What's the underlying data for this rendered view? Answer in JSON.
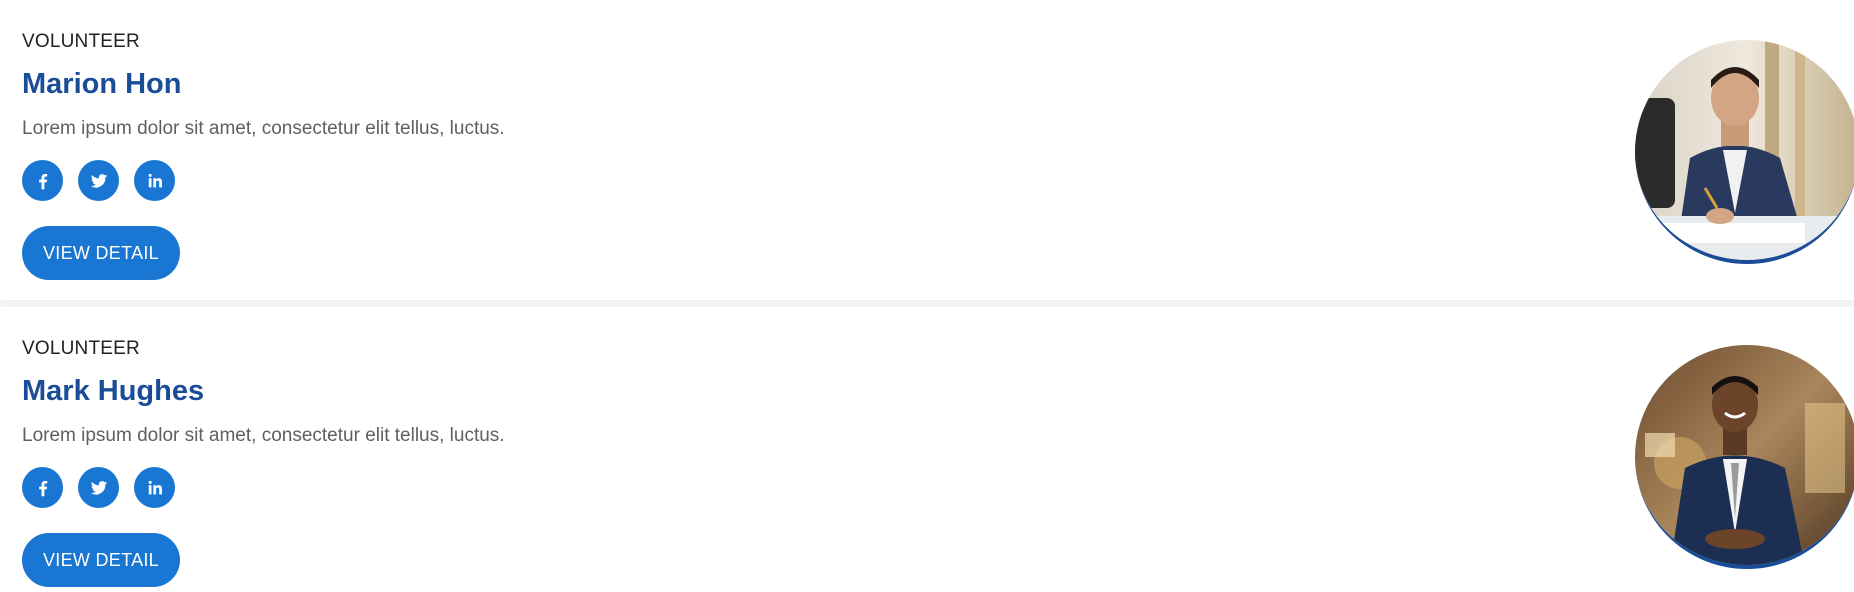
{
  "volunteers": [
    {
      "role": "VOLUNTEER",
      "name": "Marion Hon",
      "description": "Lorem ipsum dolor sit amet, consectetur elit tellus, luctus.",
      "socials": [
        "facebook-icon",
        "twitter-icon",
        "linkedin-icon"
      ],
      "button_label": "VIEW DETAIL"
    },
    {
      "role": "VOLUNTEER",
      "name": "Mark Hughes",
      "description": "Lorem ipsum dolor sit amet, consectetur elit tellus, luctus.",
      "socials": [
        "facebook-icon",
        "twitter-icon",
        "linkedin-icon"
      ],
      "button_label": "VIEW DETAIL"
    }
  ],
  "colors": {
    "accent": "#1976d2",
    "name": "#1a4d97",
    "body_text": "#5f5f5f"
  }
}
